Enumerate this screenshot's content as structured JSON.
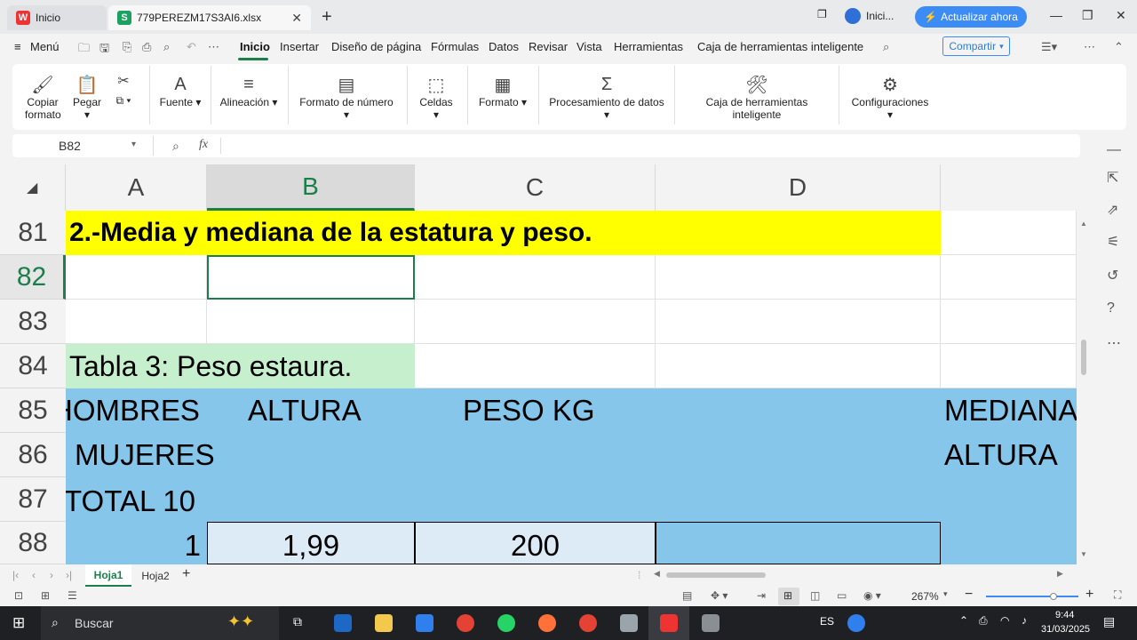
{
  "titlebar": {
    "home_tab": "Inicio",
    "file_tab": "779PEREZM17S3AI6.xlsx",
    "account": "Inici...",
    "upgrade": "Actualizar ahora"
  },
  "menubar": {
    "menu": "Menú",
    "items": [
      "Inicio",
      "Insertar",
      "Diseño de página",
      "Fórmulas",
      "Datos",
      "Revisar",
      "Vista",
      "Herramientas",
      "Caja de herramientas inteligente"
    ],
    "share": "Compartir"
  },
  "ribbon": {
    "copy_format_1": "Copiar",
    "copy_format_2": "formato",
    "paste": "Pegar",
    "font": "Fuente",
    "alignment": "Alineación",
    "number_format": "Formato de número",
    "cells": "Celdas",
    "format": "Formato",
    "data_processing": "Procesamiento de datos",
    "smart_toolbox": "Caja de herramientas inteligente",
    "settings": "Configuraciones"
  },
  "formula_bar": {
    "cell_ref": "B82",
    "fx": "fx",
    "value": ""
  },
  "sheet": {
    "columns": [
      "A",
      "B",
      "C",
      "D"
    ],
    "rows": [
      "81",
      "82",
      "83",
      "84",
      "85",
      "86",
      "87",
      "88"
    ],
    "title": "2.-Media y mediana de la estatura y peso.",
    "table_title": "Tabla 3: Peso  estaura.",
    "hombres": "HOMBRES",
    "altura": "ALTURA",
    "peso": "PESO KG",
    "mediana": "MEDIANA",
    "mujeres": "MUJERES",
    "altura2": "ALTURA",
    "total": "TOTAL  10",
    "r88_a": "1",
    "r88_b": "1,99",
    "r88_c": "200"
  },
  "sheet_tabs": [
    "Hoja1",
    "Hoja2"
  ],
  "status": {
    "zoom": "267%"
  },
  "taskbar": {
    "search": "Buscar",
    "lang": "ES",
    "time": "9:44",
    "date": "31/03/2025"
  },
  "colors": {
    "yellow": "#ffff00",
    "green_fill": "#c6efce",
    "blue_fill": "#85c6ea",
    "light_blue": "#ddebf7",
    "accent": "#1a7f4b"
  }
}
